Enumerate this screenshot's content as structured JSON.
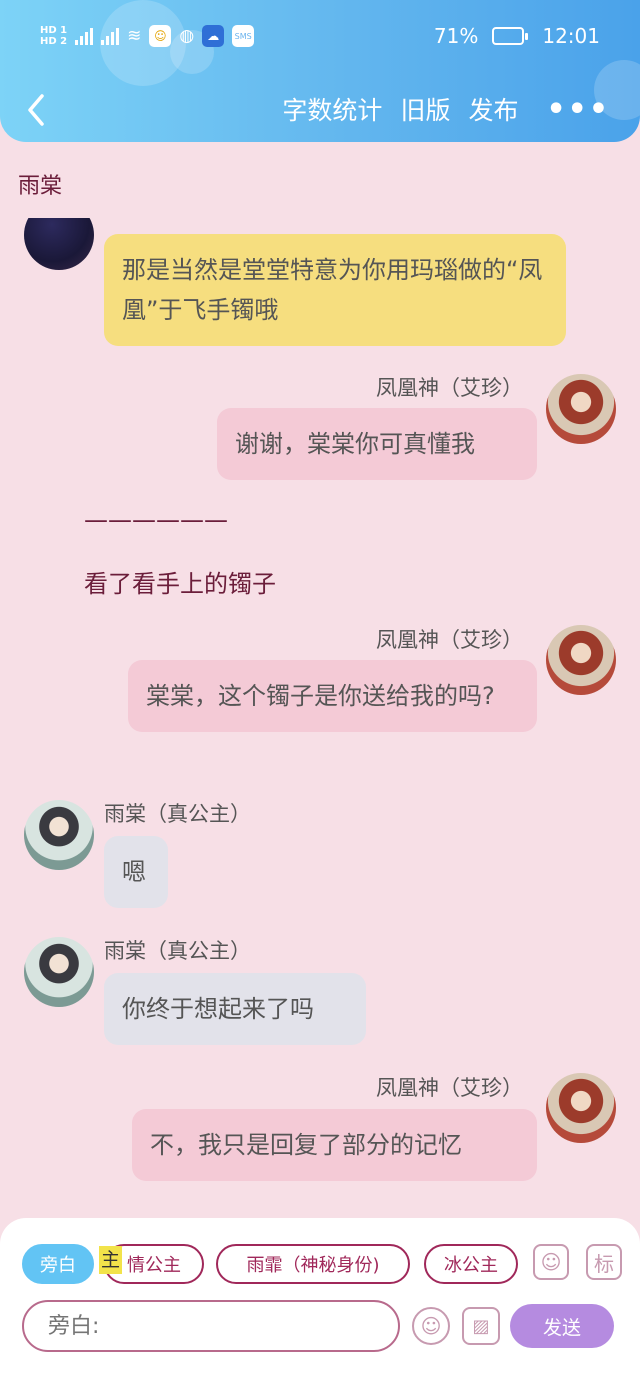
{
  "status_bar": {
    "battery": "71%",
    "battery_level": 0.71,
    "time": "12:01"
  },
  "nav": {
    "word_count": "字数统计",
    "old_version": "旧版",
    "publish": "发布",
    "more": "•••"
  },
  "chat_title": "雨棠",
  "messages": [
    {
      "side": "left",
      "avatar": "dark-avatar",
      "text": "那是当然是堂堂特意为你用玛瑙做的“凤凰”于飞手镯哦",
      "bubble": "yellow"
    },
    {
      "side": "right",
      "name": "凤凰神（艾珍）",
      "avatar": "warrior-avatar",
      "text": "谢谢，棠棠你可真懂我",
      "bubble": "pink"
    },
    {
      "narration": "——————"
    },
    {
      "narration": "看了看手上的镯子"
    },
    {
      "side": "right",
      "name": "凤凰神（艾珍）",
      "avatar": "warrior-avatar",
      "text": "棠棠，这个镯子是你送给我的吗?",
      "bubble": "pink"
    },
    {
      "side": "left",
      "name": "雨棠（真公主）",
      "avatar": "princess-avatar",
      "text": "嗯",
      "bubble": "grey"
    },
    {
      "side": "left",
      "name": "雨棠（真公主）",
      "avatar": "princess-avatar",
      "text": "你终于想起来了吗",
      "bubble": "grey"
    },
    {
      "side": "right",
      "name": "凤凰神（艾珍）",
      "avatar": "warrior-avatar",
      "text": "不，我只是回复了部分的记忆",
      "bubble": "pink"
    }
  ],
  "composer": {
    "chips": [
      "旁白",
      "情公主",
      "雨霏（神秘身份)",
      "冰公主"
    ],
    "highlight_char": "主",
    "tool_label": "标",
    "input_placeholder": "旁白:",
    "send": "发送"
  },
  "colors": {
    "header_start": "#7dd3f7",
    "header_end": "#4aa2ea",
    "background": "#f7dfe6",
    "accent": "#a0285a",
    "send": "#b58be0"
  }
}
